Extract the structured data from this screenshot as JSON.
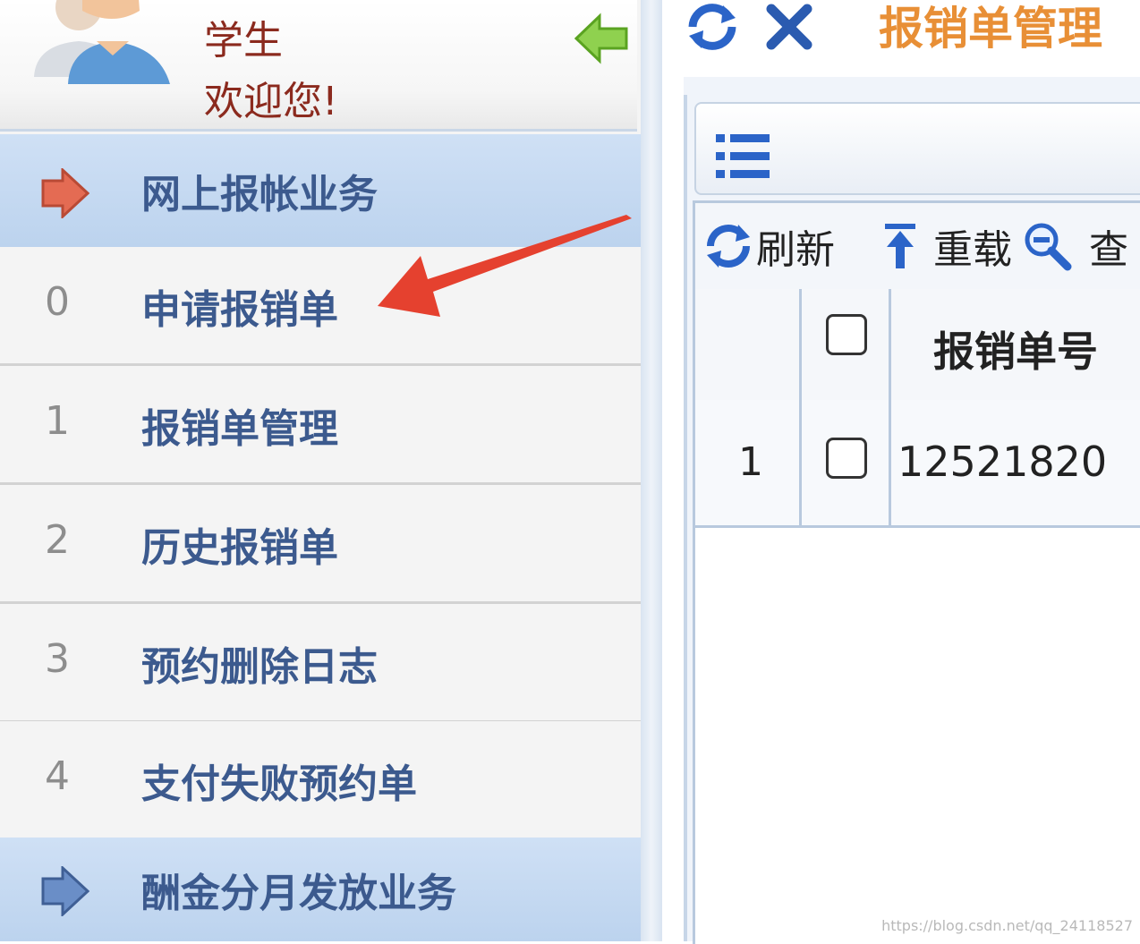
{
  "user": {
    "role": "学生",
    "welcome": "欢迎您!"
  },
  "sidebar": {
    "groups": [
      {
        "label": "网上报帐业务",
        "icon": "arrow-right-icon",
        "color": "#e46b53"
      },
      {
        "label": "酬金分月发放业务",
        "icon": "arrow-right-icon",
        "color": "#6a8ec7"
      }
    ],
    "items": [
      {
        "num": "0",
        "label": "申请报销单"
      },
      {
        "num": "1",
        "label": "报销单管理"
      },
      {
        "num": "2",
        "label": "历史报销单"
      },
      {
        "num": "3",
        "label": "预约删除日志"
      },
      {
        "num": "4",
        "label": "支付失败预约单"
      }
    ]
  },
  "tab": {
    "title": "报销单管理",
    "title_color": "#e88f36"
  },
  "toolbar": {
    "refresh_label": "刷新",
    "reload_label": "重载",
    "search_label": "查"
  },
  "table": {
    "columns": [
      "报销单号"
    ],
    "rows": [
      {
        "index": "1",
        "number": "12521820"
      }
    ]
  },
  "watermark": "https://blog.csdn.net/qq_24118527",
  "colors": {
    "accent_blue": "#3c5a8e",
    "annotation_red": "#e5412f"
  }
}
